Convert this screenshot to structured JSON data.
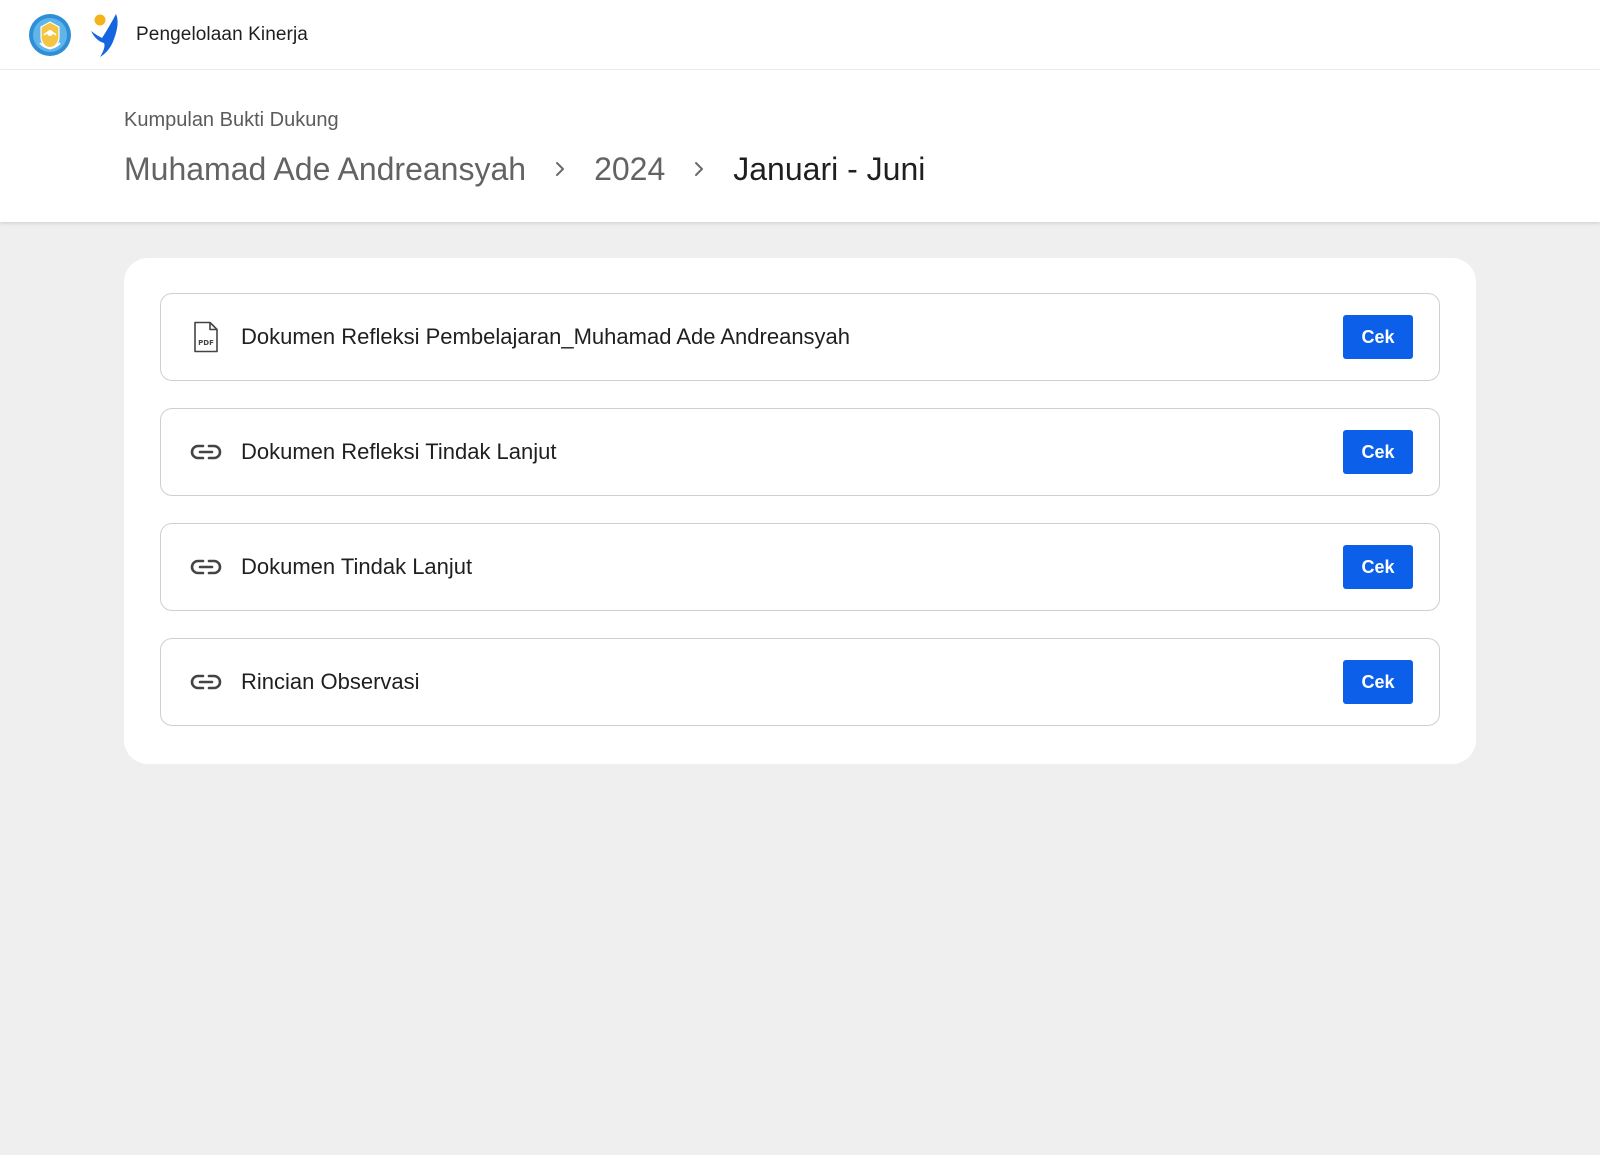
{
  "app": {
    "title": "Pengelolaan Kinerja"
  },
  "header": {
    "section_label": "Kumpulan Bukti Dukung",
    "breadcrumb": [
      {
        "label": "Muhamad Ade Andreansyah"
      },
      {
        "label": "2024"
      },
      {
        "label": "Januari - Juni"
      }
    ]
  },
  "documents": [
    {
      "title": "Dokumen Refleksi Pembelajaran_Muhamad Ade Andreansyah",
      "icon": "pdf-file-icon",
      "action_label": "Cek"
    },
    {
      "title": "Dokumen Refleksi Tindak Lanjut",
      "icon": "link-icon",
      "action_label": "Cek"
    },
    {
      "title": "Dokumen Tindak Lanjut",
      "icon": "link-icon",
      "action_label": "Cek"
    },
    {
      "title": "Rincian Observasi",
      "icon": "link-icon",
      "action_label": "Cek"
    }
  ],
  "colors": {
    "primary_button": "#0b5fe8",
    "page_background": "#efefef",
    "brand_blue": "#1565e0",
    "brand_yellow": "#f5b21b"
  }
}
